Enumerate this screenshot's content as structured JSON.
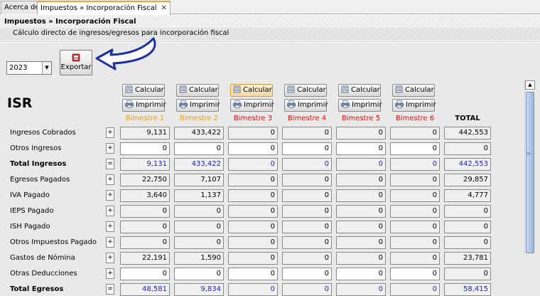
{
  "tabs": [
    {
      "label": "Acerca de",
      "active": false
    },
    {
      "label": "Impuestos » Incorporación Fiscal",
      "active": true
    }
  ],
  "header": {
    "title": "Impuestos » Incorporación Fiscal",
    "description": "Cálculo directo de ingresos/egresos para incorporación fiscal"
  },
  "toolbar": {
    "year": "2023",
    "export_label": "Exportar"
  },
  "section_title": "ISR",
  "buttons": {
    "calc_label": "Calcular",
    "print_label": "Imprimir"
  },
  "periods": [
    {
      "name": "Bimestre 1",
      "status": "paid"
    },
    {
      "name": "Bimestre 2",
      "status": "paid"
    },
    {
      "name": "Bimestre 3",
      "status": "pending"
    },
    {
      "name": "Bimestre 4",
      "status": "pending"
    },
    {
      "name": "Bimestre 5",
      "status": "pending"
    },
    {
      "name": "Bimestre 6",
      "status": "pending"
    }
  ],
  "total_header": "TOTAL",
  "colors": {
    "paid": "#e0a020",
    "pending": "#e01010",
    "computed_value": "#1e1eb4"
  },
  "rows": [
    {
      "label": "Ingresos Cobrados",
      "op": "+",
      "bold": false,
      "kind": "ro",
      "values": [
        "9,131",
        "433,422",
        "0",
        "0",
        "0",
        "0"
      ],
      "total": "442,553"
    },
    {
      "label": "Otros Ingresos",
      "op": "+",
      "bold": false,
      "kind": "ed",
      "values": [
        "0",
        "0",
        "0",
        "0",
        "0",
        "0"
      ],
      "total": "0"
    },
    {
      "label": "Total Ingresos",
      "op": "=",
      "bold": true,
      "kind": "blue",
      "values": [
        "9,131",
        "433,422",
        "0",
        "0",
        "0",
        "0"
      ],
      "total": "442,553"
    },
    {
      "label": "Egresos Pagados",
      "op": "+",
      "bold": false,
      "kind": "ro",
      "values": [
        "22,750",
        "7,107",
        "0",
        "0",
        "0",
        "0"
      ],
      "total": "29,857"
    },
    {
      "label": "IVA Pagado",
      "op": "+",
      "bold": false,
      "kind": "ro",
      "values": [
        "3,640",
        "1,137",
        "0",
        "0",
        "0",
        "0"
      ],
      "total": "4,777"
    },
    {
      "label": "IEPS Pagado",
      "op": "+",
      "bold": false,
      "kind": "ro",
      "values": [
        "0",
        "0",
        "0",
        "0",
        "0",
        "0"
      ],
      "total": "0"
    },
    {
      "label": "ISH Pagado",
      "op": "+",
      "bold": false,
      "kind": "ro",
      "values": [
        "0",
        "0",
        "0",
        "0",
        "0",
        "0"
      ],
      "total": "0"
    },
    {
      "label": "Otros Impuestos Pagado",
      "op": "+",
      "bold": false,
      "kind": "ro",
      "values": [
        "0",
        "0",
        "0",
        "0",
        "0",
        "0"
      ],
      "total": "0"
    },
    {
      "label": "Gastos de Nómina",
      "op": "+",
      "bold": false,
      "kind": "ro",
      "values": [
        "22,191",
        "1,590",
        "0",
        "0",
        "0",
        "0"
      ],
      "total": "23,781"
    },
    {
      "label": "Otras Deducciones",
      "op": "+",
      "bold": false,
      "kind": "ed",
      "values": [
        "0",
        "0",
        "0",
        "0",
        "0",
        "0"
      ],
      "total": "0"
    },
    {
      "label": "Total Egresos",
      "op": "=",
      "bold": true,
      "kind": "blue",
      "values": [
        "48,581",
        "9,834",
        "0",
        "0",
        "0",
        "0"
      ],
      "total": "58,415"
    }
  ]
}
